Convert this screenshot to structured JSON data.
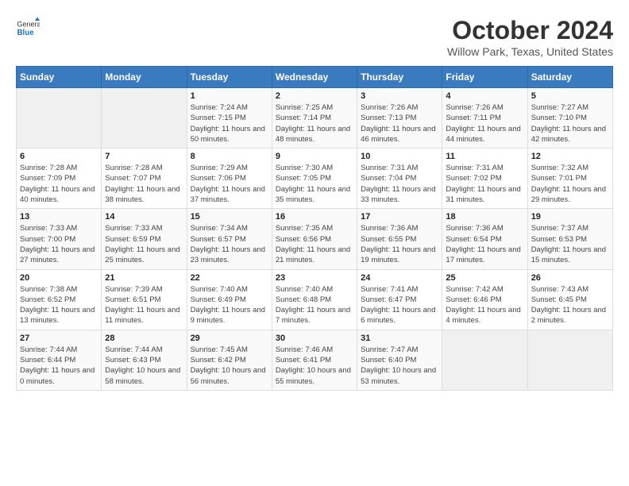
{
  "header": {
    "logo_general": "General",
    "logo_blue": "Blue",
    "month": "October 2024",
    "location": "Willow Park, Texas, United States"
  },
  "days_of_week": [
    "Sunday",
    "Monday",
    "Tuesday",
    "Wednesday",
    "Thursday",
    "Friday",
    "Saturday"
  ],
  "weeks": [
    [
      {
        "day": "",
        "info": ""
      },
      {
        "day": "",
        "info": ""
      },
      {
        "day": "1",
        "info": "Sunrise: 7:24 AM\nSunset: 7:15 PM\nDaylight: 11 hours and 50 minutes."
      },
      {
        "day": "2",
        "info": "Sunrise: 7:25 AM\nSunset: 7:14 PM\nDaylight: 11 hours and 48 minutes."
      },
      {
        "day": "3",
        "info": "Sunrise: 7:26 AM\nSunset: 7:13 PM\nDaylight: 11 hours and 46 minutes."
      },
      {
        "day": "4",
        "info": "Sunrise: 7:26 AM\nSunset: 7:11 PM\nDaylight: 11 hours and 44 minutes."
      },
      {
        "day": "5",
        "info": "Sunrise: 7:27 AM\nSunset: 7:10 PM\nDaylight: 11 hours and 42 minutes."
      }
    ],
    [
      {
        "day": "6",
        "info": "Sunrise: 7:28 AM\nSunset: 7:09 PM\nDaylight: 11 hours and 40 minutes."
      },
      {
        "day": "7",
        "info": "Sunrise: 7:28 AM\nSunset: 7:07 PM\nDaylight: 11 hours and 38 minutes."
      },
      {
        "day": "8",
        "info": "Sunrise: 7:29 AM\nSunset: 7:06 PM\nDaylight: 11 hours and 37 minutes."
      },
      {
        "day": "9",
        "info": "Sunrise: 7:30 AM\nSunset: 7:05 PM\nDaylight: 11 hours and 35 minutes."
      },
      {
        "day": "10",
        "info": "Sunrise: 7:31 AM\nSunset: 7:04 PM\nDaylight: 11 hours and 33 minutes."
      },
      {
        "day": "11",
        "info": "Sunrise: 7:31 AM\nSunset: 7:02 PM\nDaylight: 11 hours and 31 minutes."
      },
      {
        "day": "12",
        "info": "Sunrise: 7:32 AM\nSunset: 7:01 PM\nDaylight: 11 hours and 29 minutes."
      }
    ],
    [
      {
        "day": "13",
        "info": "Sunrise: 7:33 AM\nSunset: 7:00 PM\nDaylight: 11 hours and 27 minutes."
      },
      {
        "day": "14",
        "info": "Sunrise: 7:33 AM\nSunset: 6:59 PM\nDaylight: 11 hours and 25 minutes."
      },
      {
        "day": "15",
        "info": "Sunrise: 7:34 AM\nSunset: 6:57 PM\nDaylight: 11 hours and 23 minutes."
      },
      {
        "day": "16",
        "info": "Sunrise: 7:35 AM\nSunset: 6:56 PM\nDaylight: 11 hours and 21 minutes."
      },
      {
        "day": "17",
        "info": "Sunrise: 7:36 AM\nSunset: 6:55 PM\nDaylight: 11 hours and 19 minutes."
      },
      {
        "day": "18",
        "info": "Sunrise: 7:36 AM\nSunset: 6:54 PM\nDaylight: 11 hours and 17 minutes."
      },
      {
        "day": "19",
        "info": "Sunrise: 7:37 AM\nSunset: 6:53 PM\nDaylight: 11 hours and 15 minutes."
      }
    ],
    [
      {
        "day": "20",
        "info": "Sunrise: 7:38 AM\nSunset: 6:52 PM\nDaylight: 11 hours and 13 minutes."
      },
      {
        "day": "21",
        "info": "Sunrise: 7:39 AM\nSunset: 6:51 PM\nDaylight: 11 hours and 11 minutes."
      },
      {
        "day": "22",
        "info": "Sunrise: 7:40 AM\nSunset: 6:49 PM\nDaylight: 11 hours and 9 minutes."
      },
      {
        "day": "23",
        "info": "Sunrise: 7:40 AM\nSunset: 6:48 PM\nDaylight: 11 hours and 7 minutes."
      },
      {
        "day": "24",
        "info": "Sunrise: 7:41 AM\nSunset: 6:47 PM\nDaylight: 11 hours and 6 minutes."
      },
      {
        "day": "25",
        "info": "Sunrise: 7:42 AM\nSunset: 6:46 PM\nDaylight: 11 hours and 4 minutes."
      },
      {
        "day": "26",
        "info": "Sunrise: 7:43 AM\nSunset: 6:45 PM\nDaylight: 11 hours and 2 minutes."
      }
    ],
    [
      {
        "day": "27",
        "info": "Sunrise: 7:44 AM\nSunset: 6:44 PM\nDaylight: 11 hours and 0 minutes."
      },
      {
        "day": "28",
        "info": "Sunrise: 7:44 AM\nSunset: 6:43 PM\nDaylight: 10 hours and 58 minutes."
      },
      {
        "day": "29",
        "info": "Sunrise: 7:45 AM\nSunset: 6:42 PM\nDaylight: 10 hours and 56 minutes."
      },
      {
        "day": "30",
        "info": "Sunrise: 7:46 AM\nSunset: 6:41 PM\nDaylight: 10 hours and 55 minutes."
      },
      {
        "day": "31",
        "info": "Sunrise: 7:47 AM\nSunset: 6:40 PM\nDaylight: 10 hours and 53 minutes."
      },
      {
        "day": "",
        "info": ""
      },
      {
        "day": "",
        "info": ""
      }
    ]
  ]
}
